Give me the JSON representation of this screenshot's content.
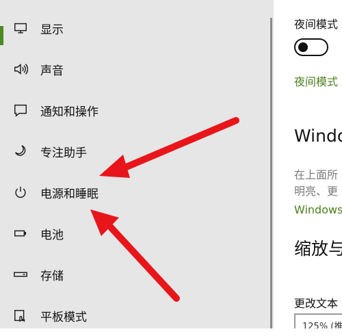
{
  "sidebar": {
    "items": [
      {
        "label": "显示",
        "icon": "monitor-icon",
        "selected": true
      },
      {
        "label": "声音",
        "icon": "speaker-icon"
      },
      {
        "label": "通知和操作",
        "icon": "notification-icon"
      },
      {
        "label": "专注助手",
        "icon": "moon-icon"
      },
      {
        "label": "电源和睡眠",
        "icon": "power-icon"
      },
      {
        "label": "电池",
        "icon": "battery-icon"
      },
      {
        "label": "存储",
        "icon": "storage-icon"
      },
      {
        "label": "平板模式",
        "icon": "tablet-mode-icon"
      }
    ]
  },
  "content": {
    "night_light_label": "夜间模式",
    "night_light_toggle_on": false,
    "night_light_settings_link": "夜间模式",
    "hd_color_heading": "Windo",
    "hd_color_desc_line1": "在上面所",
    "hd_color_desc_line2": "明亮、更",
    "hd_color_link": "Windows",
    "scale_heading": "缩放与",
    "scale_label": "更改文本",
    "scale_select_value": "125% (推"
  },
  "annotations": {
    "arrow_color": "#e8161a"
  },
  "colors": {
    "accent": "#4c8a24",
    "link": "#4b7f1d",
    "sidebar_bg": "#e6e6e6"
  }
}
